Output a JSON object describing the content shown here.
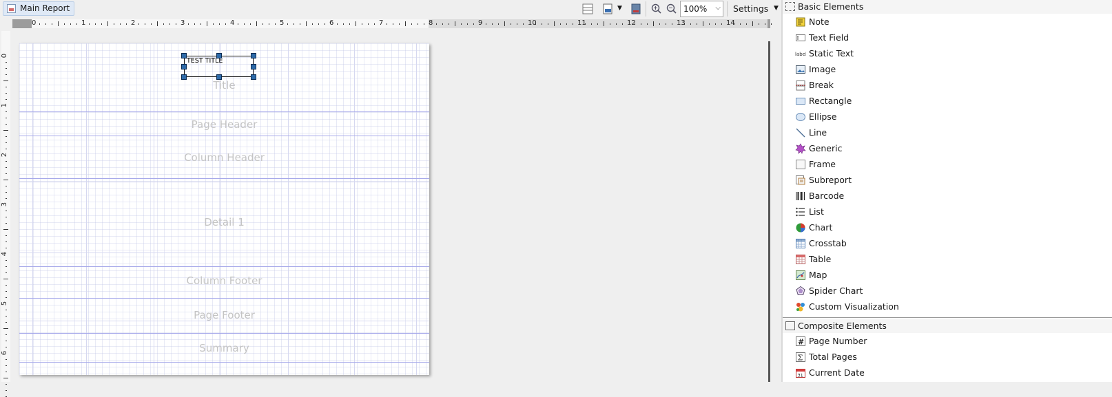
{
  "toolbar": {
    "main_report_tab": "Main Report",
    "zoom_value": "100%",
    "settings_label": "Settings"
  },
  "ruler": {
    "horizontal_numbers": [
      "0",
      "1",
      "2",
      "3",
      "4",
      "5",
      "6",
      "7",
      "8",
      "9",
      "10",
      "11",
      "12",
      "13",
      "14"
    ],
    "vertical_numbers": [
      "0",
      "1",
      "2",
      "3",
      "4",
      "5",
      "6"
    ]
  },
  "report": {
    "selected_element_text": "TEST TITLE",
    "bands": {
      "title": "Title",
      "page_header": "Page Header",
      "column_header": "Column Header",
      "detail": "Detail 1",
      "column_footer": "Column Footer",
      "page_footer": "Page Footer",
      "summary": "Summary"
    }
  },
  "palette": {
    "basic_title": "Basic Elements",
    "basic_items": [
      {
        "label": "Note",
        "icon": "note-icon"
      },
      {
        "label": "Text Field",
        "icon": "text-field-icon"
      },
      {
        "label": "Static Text",
        "icon": "static-text-icon"
      },
      {
        "label": "Image",
        "icon": "image-icon"
      },
      {
        "label": "Break",
        "icon": "break-icon"
      },
      {
        "label": "Rectangle",
        "icon": "rectangle-icon"
      },
      {
        "label": "Ellipse",
        "icon": "ellipse-icon"
      },
      {
        "label": "Line",
        "icon": "line-icon"
      },
      {
        "label": "Generic",
        "icon": "generic-icon"
      },
      {
        "label": "Frame",
        "icon": "frame-icon"
      },
      {
        "label": "Subreport",
        "icon": "subreport-icon"
      },
      {
        "label": "Barcode",
        "icon": "barcode-icon"
      },
      {
        "label": "List",
        "icon": "list-icon"
      },
      {
        "label": "Chart",
        "icon": "chart-icon"
      },
      {
        "label": "Crosstab",
        "icon": "crosstab-icon"
      },
      {
        "label": "Table",
        "icon": "table-icon"
      },
      {
        "label": "Map",
        "icon": "map-icon"
      },
      {
        "label": "Spider Chart",
        "icon": "spider-chart-icon"
      },
      {
        "label": "Custom Visualization",
        "icon": "custom-visualization-icon"
      }
    ],
    "composite_title": "Composite Elements",
    "composite_items": [
      {
        "label": "Page Number",
        "icon": "page-number-icon"
      },
      {
        "label": "Total Pages",
        "icon": "total-pages-icon"
      },
      {
        "label": "Current Date",
        "icon": "current-date-icon"
      }
    ],
    "static_text_icon_glyph": "label"
  }
}
